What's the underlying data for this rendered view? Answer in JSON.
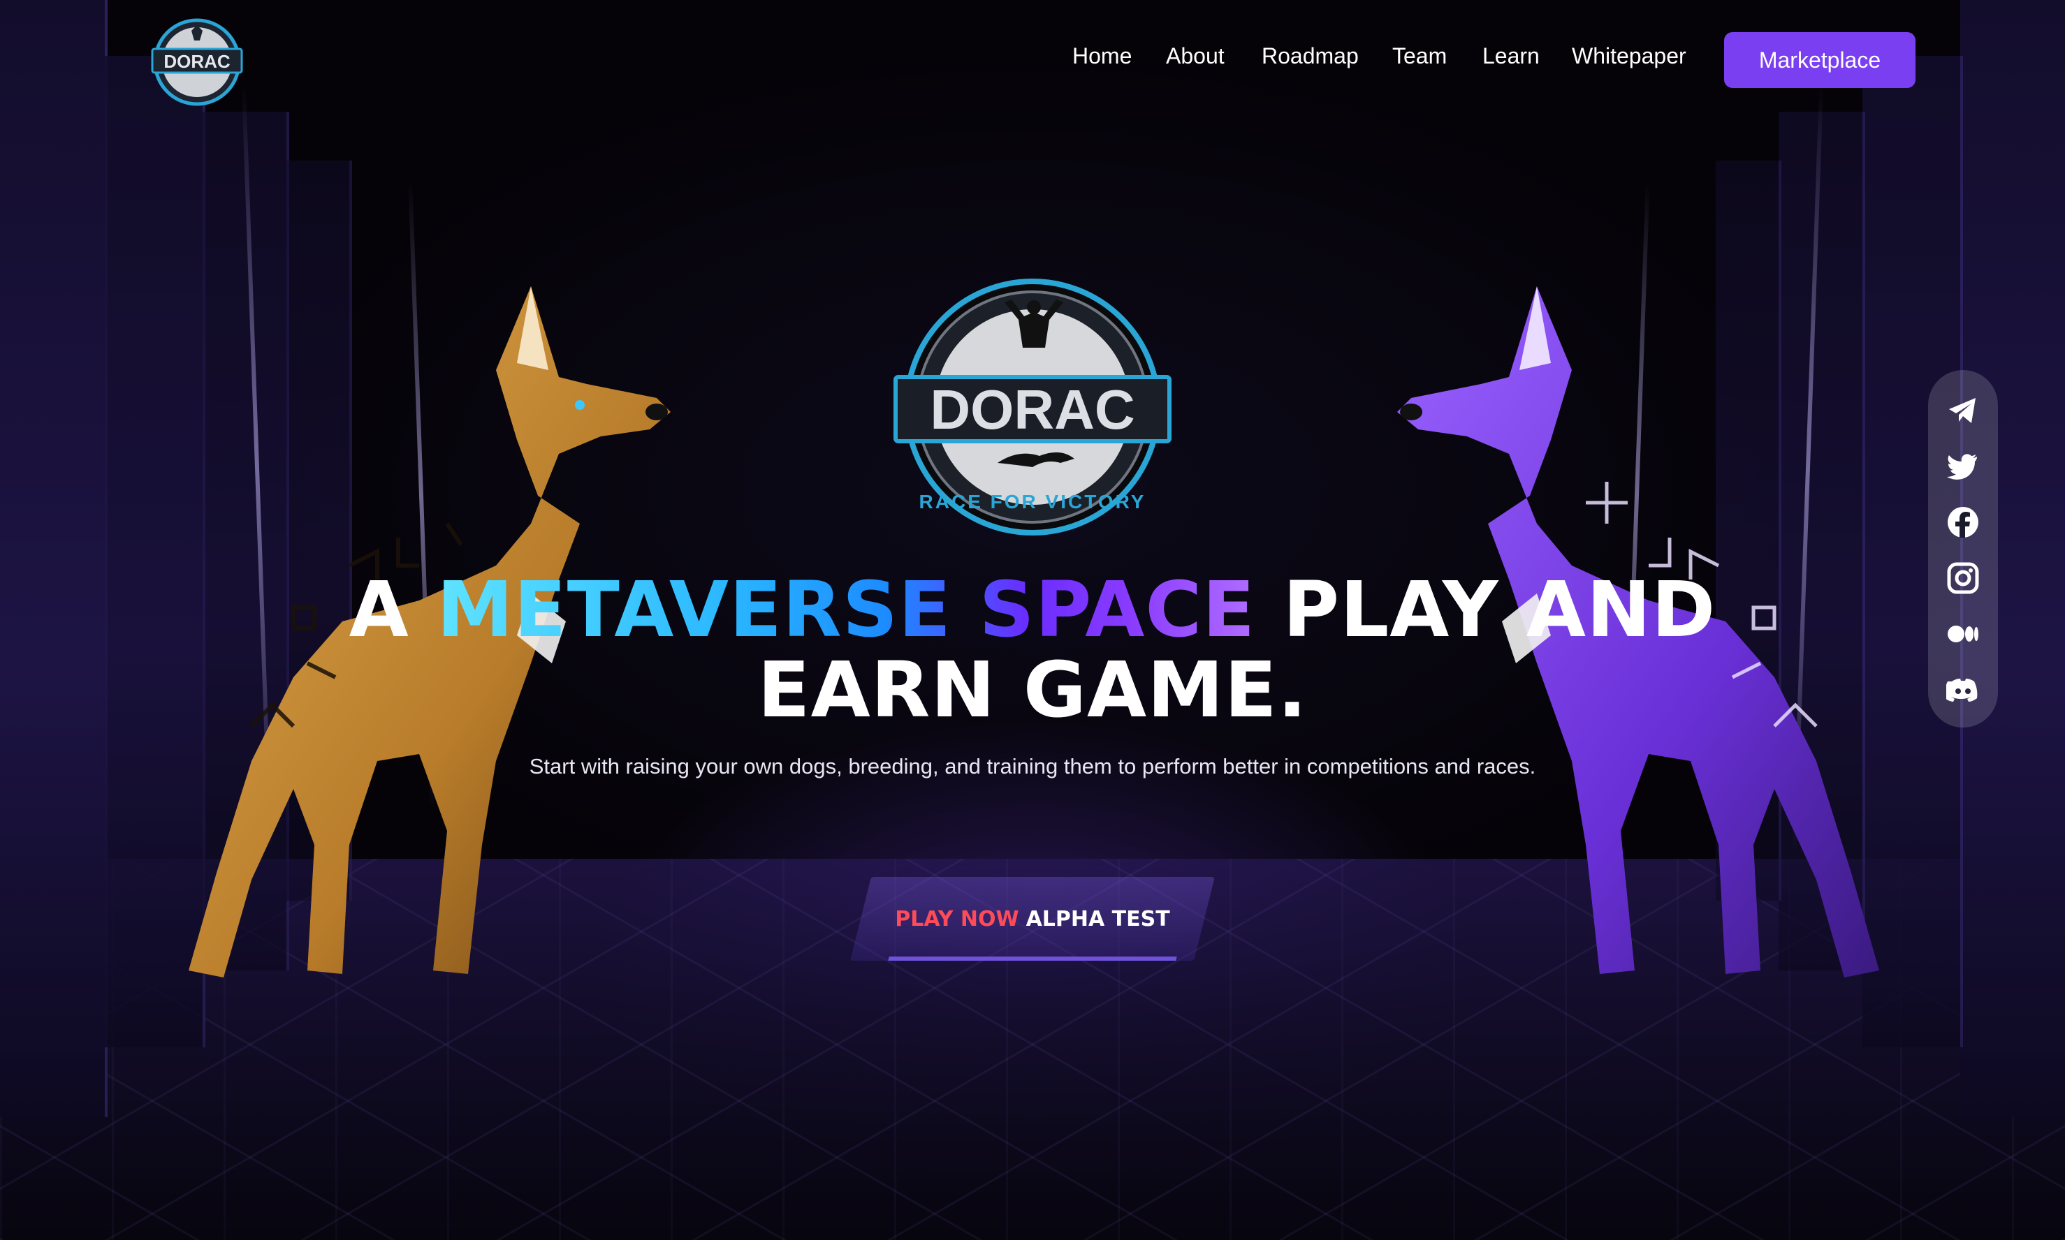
{
  "brand": {
    "logo_text": "DORAC",
    "logo_tagline": "RACE FOR VICTORY"
  },
  "nav": {
    "items": [
      {
        "label": "Home"
      },
      {
        "label": "About"
      },
      {
        "label": "Roadmap"
      },
      {
        "label": "Team"
      },
      {
        "label": "Learn"
      },
      {
        "label": "Whitepaper"
      }
    ],
    "cta_label": "Marketplace"
  },
  "hero": {
    "headline_part1": "A ",
    "headline_part2": "METAVERSE SPACE",
    "headline_part3": " PLAY AND",
    "headline_line2": "EARN GAME.",
    "subtitle": "Start with raising your own dogs, breeding, and training them to perform better in competitions and races.",
    "cta_red": "PLAY NOW",
    "cta_white": "ALPHA TEST"
  },
  "social": [
    {
      "icon": "telegram-icon"
    },
    {
      "icon": "twitter-icon"
    },
    {
      "icon": "facebook-icon"
    },
    {
      "icon": "instagram-icon"
    },
    {
      "icon": "medium-icon"
    },
    {
      "icon": "discord-icon"
    }
  ],
  "colors": {
    "accent": "#7b3ff2",
    "cta_red": "#ff4b57",
    "gradient_cyan": "#5fe3ff",
    "gradient_purple": "#8a3cff",
    "left_dog": "#c9923d",
    "right_dog": "#7a3fe0"
  }
}
